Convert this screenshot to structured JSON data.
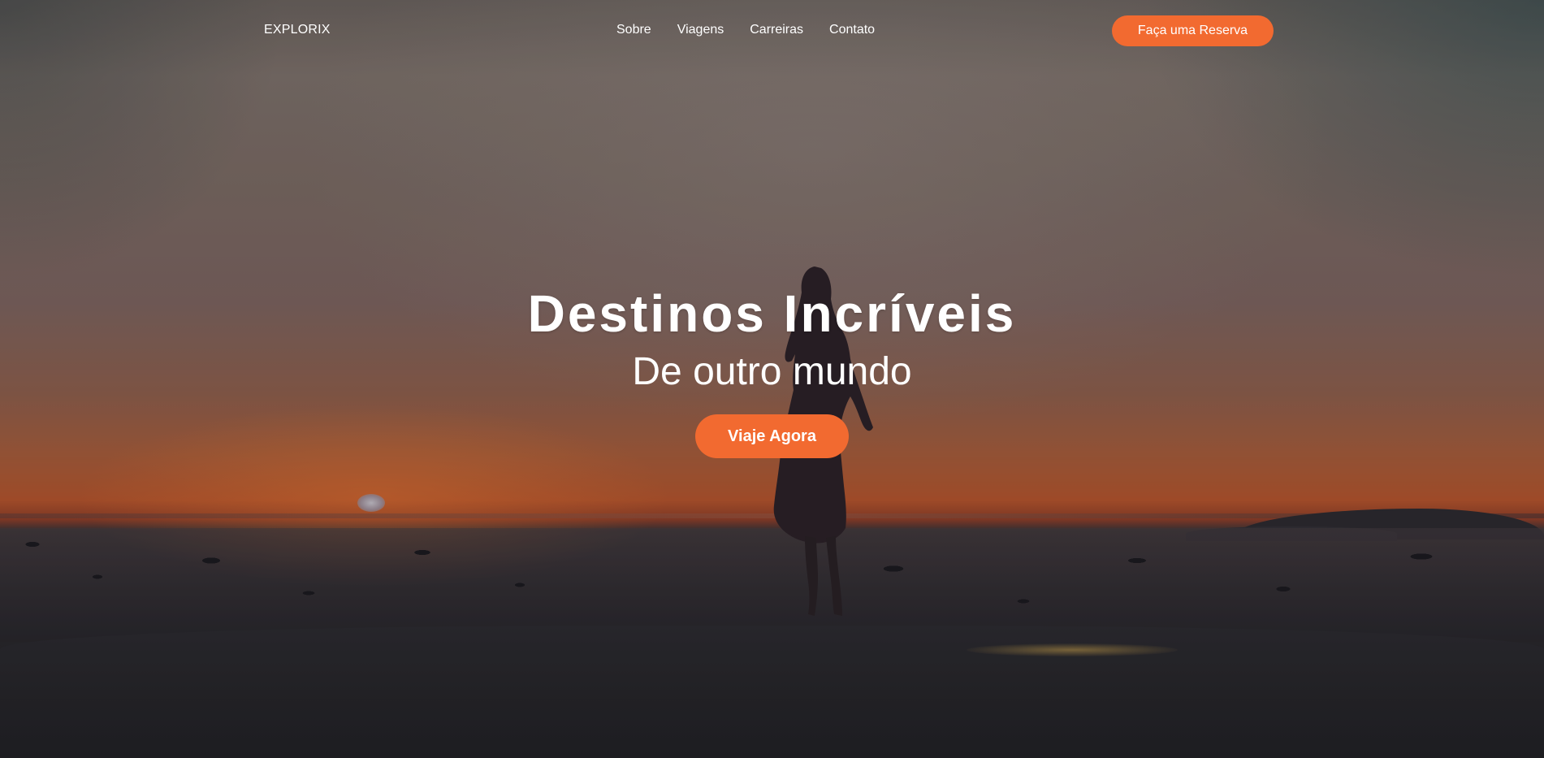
{
  "brand": {
    "logo": "EXPLORIX"
  },
  "nav": {
    "links": [
      {
        "label": "Sobre"
      },
      {
        "label": "Viagens"
      },
      {
        "label": "Carreiras"
      },
      {
        "label": "Contato"
      }
    ],
    "cta_label": "Faça uma Reserva"
  },
  "hero": {
    "title": "Destinos Incríveis",
    "subtitle": "De outro mundo",
    "cta_label": "Viaje Agora",
    "background": "sunset-beach-silhouette-photo"
  },
  "colors": {
    "accent": "#f26a30",
    "text": "#ffffff"
  }
}
